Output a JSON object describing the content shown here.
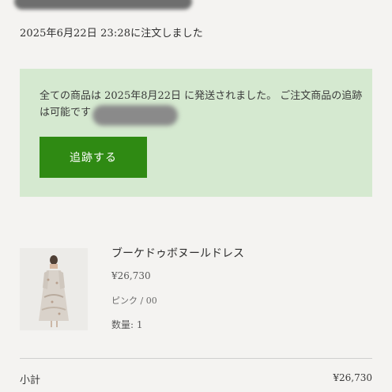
{
  "order": {
    "date_text": "2025年6月22日 23:28に注文しました"
  },
  "shipping_notice": {
    "text": "全ての商品は 2025年8月22日 に発送されました。 ご注文商品の追跡は可能です",
    "track_button_label": "追跡する",
    "background_color": "#d5e9d0",
    "button_color": "#2f8a13"
  },
  "product": {
    "name": "ブーケドゥボヌールドレス",
    "price": "¥26,730",
    "variant": "ピンク / 00",
    "quantity_text": "数量: 1",
    "image_icon": "dress-photo"
  },
  "summary": {
    "subtotal_label": "小計",
    "subtotal_value": "¥26,730"
  }
}
